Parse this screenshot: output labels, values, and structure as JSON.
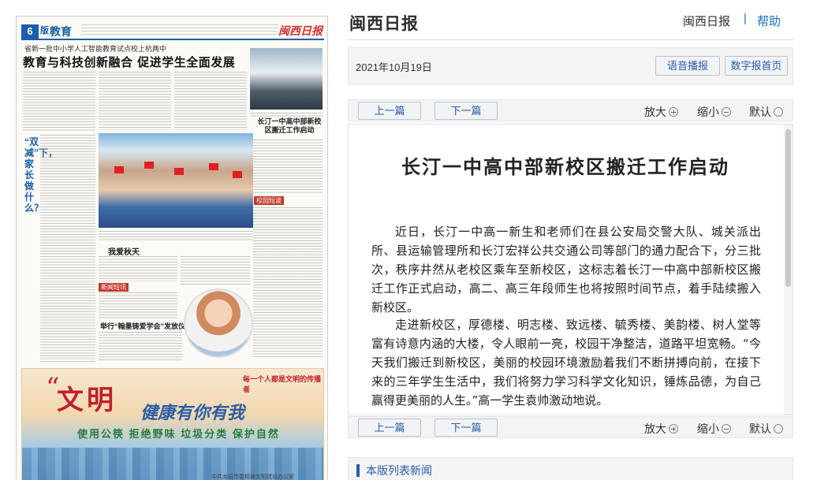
{
  "paper": {
    "page_num": "6",
    "page_label": "版",
    "section": "教育",
    "masthead": "闽西日报",
    "kicker": "省新一批中小学人工智能教育试点校上杭两中",
    "headline": "教育与科技创新融合 促进学生全面发展",
    "vertical_title": "“双减”下，家长做什么？",
    "box_title": "长汀一中高中部新校区搬迁工作启动",
    "column_title": "我爱秋天",
    "subhead": "举行“翰墨铸爱学会”发放仪式",
    "tag_campus": "校园短波",
    "tag_news": "新闻短讯",
    "ad_big": "文明",
    "ad_mid": "健康有你有我",
    "ad_line": "使用公筷 拒绝野味 垃圾分类 保护自然",
    "ad_side": "每一个人都是文明的传播者",
    "ad_org": "中共龙岩市委精神文明建设办公室"
  },
  "site": {
    "title": "闽西日报",
    "top_link": "闽西日报",
    "separator": "|",
    "help": "帮助"
  },
  "date_bar": {
    "date": "2021年10月19日",
    "voice_button": "语音播报",
    "epaper_button": "数字报首页"
  },
  "nav": {
    "prev": "上一篇",
    "next": "下一篇",
    "zoom_in": "放大",
    "zoom_out": "缩小",
    "default": "默认"
  },
  "article": {
    "title": "长汀一中高中部新校区搬迁工作启动",
    "paragraphs": [
      "近日，长汀一中高一新生和老师们在县公安局交警大队、城关派出所、县运输管理所和长汀宏祥公共交通公司等部门的通力配合下，分三批次，秩序井然从老校区乘车至新校区，这标志着长汀一中高中部新校区搬迁工作正式启动，高二、高三年段师生也将按照时间节点，着手陆续搬入新校区。",
      "走进新校区，厚德楼、明志楼、致远楼、毓秀楼、美韵楼、树人堂等富有诗意内涵的大楼，令人眼前一亮，校园干净整洁，道路平坦宽畅。“今天我们搬迁到新校区，美丽的校园环境激励着我们不断拼搏向前，在接下来的三年学生生活中，我们将努力学习科学文化知识，锤炼品德，为自己赢得更美丽的人生。”高一学生袁帅激动地说。"
    ]
  },
  "list": {
    "label": "本版列表新闻"
  }
}
